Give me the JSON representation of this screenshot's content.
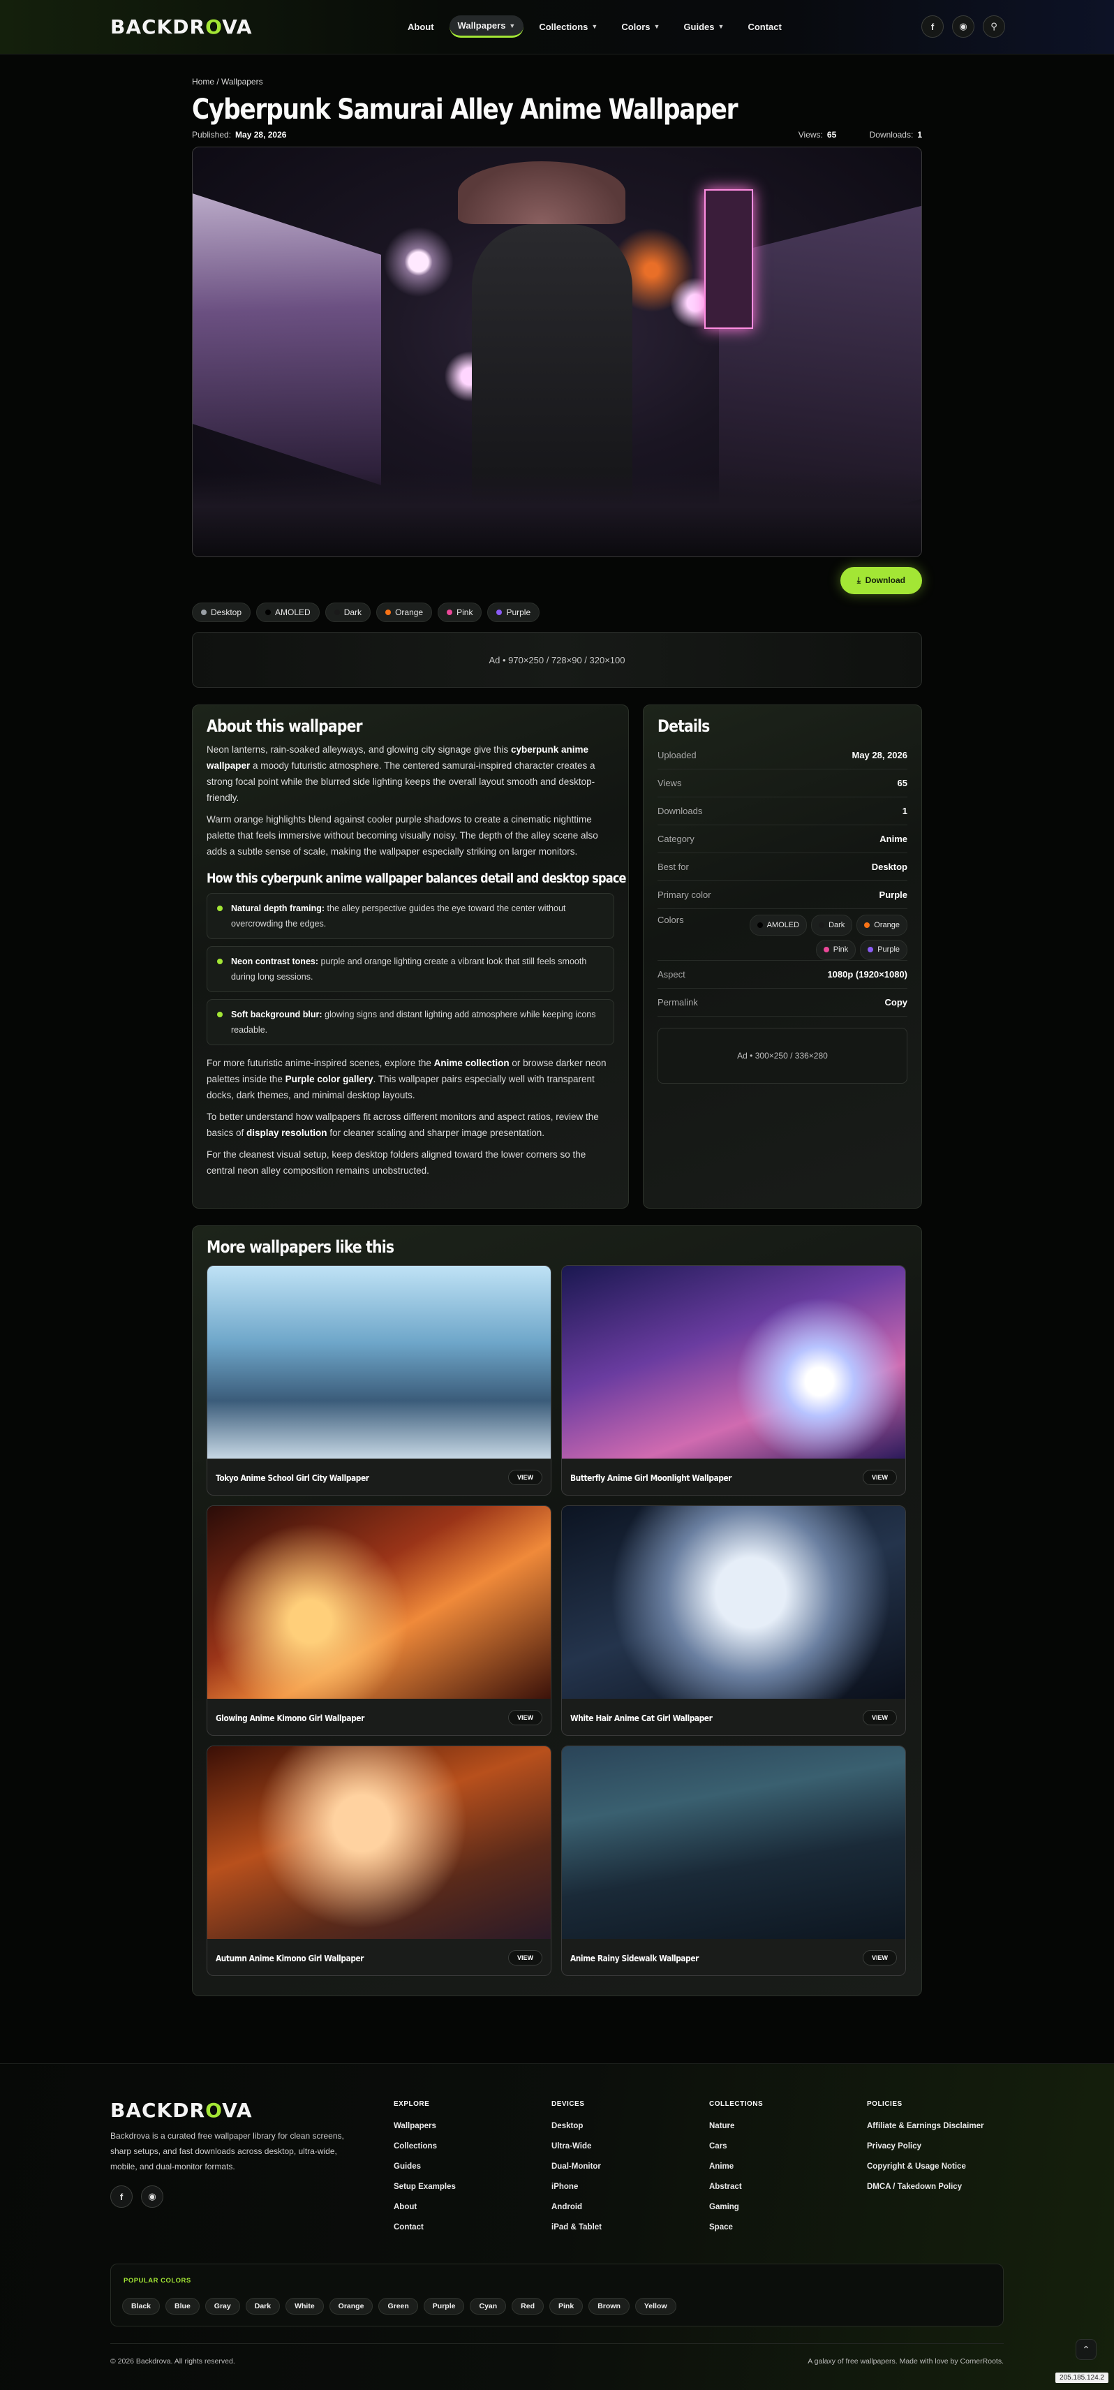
{
  "header": {
    "logo": "BACKDROVA",
    "nav": [
      {
        "label": "About",
        "caret": false,
        "active": false
      },
      {
        "label": "Wallpapers",
        "caret": true,
        "active": true
      },
      {
        "label": "Collections",
        "caret": true,
        "active": false
      },
      {
        "label": "Colors",
        "caret": true,
        "active": false
      },
      {
        "label": "Guides",
        "caret": true,
        "active": false
      },
      {
        "label": "Contact",
        "caret": false,
        "active": false
      }
    ],
    "icons": [
      "facebook-icon",
      "instagram-icon",
      "search-icon"
    ]
  },
  "page": {
    "breadcrumb": "Home / Wallpapers",
    "title": "Cyberpunk Samurai Alley Anime Wallpaper",
    "published_label": "Published:",
    "published": "May 28, 2026",
    "views_label": "Views:",
    "views": "65",
    "downloads_label": "Downloads:",
    "downloads": "1",
    "download_button": "Download",
    "chips": [
      {
        "label": "Desktop",
        "color": "#9aa0a6"
      },
      {
        "label": "AMOLED",
        "color": "#000000"
      },
      {
        "label": "Dark",
        "color": "#1a1a1a"
      },
      {
        "label": "Orange",
        "color": "#f97316"
      },
      {
        "label": "Pink",
        "color": "#ec4899"
      },
      {
        "label": "Purple",
        "color": "#8b5cf6"
      }
    ],
    "ad_banner": "Ad • 970×250 / 728×90 / 320×100"
  },
  "about": {
    "heading": "About this wallpaper",
    "p1_a": "Neon lanterns, rain-soaked alleyways, and glowing city signage give this ",
    "p1_b": "cyberpunk anime wallpaper",
    "p1_c": " a moody futuristic atmosphere. The centered samurai-inspired character creates a strong focal point while the blurred side lighting keeps the overall layout smooth and desktop-friendly.",
    "p2": "Warm orange highlights blend against cooler purple shadows to create a cinematic nighttime palette that feels immersive without becoming visually noisy. The depth of the alley scene also adds a subtle sense of scale, making the wallpaper especially striking on larger monitors.",
    "subheading": "How this cyberpunk anime wallpaper balances detail and desktop space",
    "bullets": [
      {
        "title": "Natural depth framing:",
        "text": " the alley perspective guides the eye toward the center without overcrowding the edges."
      },
      {
        "title": "Neon contrast tones:",
        "text": " purple and orange lighting create a vibrant look that still feels smooth during long sessions."
      },
      {
        "title": "Soft background blur:",
        "text": " glowing signs and distant lighting add atmosphere while keeping icons readable."
      }
    ],
    "p3_a": "For more futuristic anime-inspired scenes, explore the ",
    "p3_b": "Anime collection",
    "p3_c": " or browse darker neon palettes inside the ",
    "p3_d": "Purple color gallery",
    "p3_e": ". This wallpaper pairs especially well with transparent docks, dark themes, and minimal desktop layouts.",
    "p4_a": "To better understand how wallpapers fit across different monitors and aspect ratios, review the basics of ",
    "p4_b": "display resolution",
    "p4_c": " for cleaner scaling and sharper image presentation.",
    "p5": "For the cleanest visual setup, keep desktop folders aligned toward the lower corners so the central neon alley composition remains unobstructed."
  },
  "details": {
    "heading": "Details",
    "rows": [
      {
        "k": "Uploaded",
        "v": "May 28, 2026"
      },
      {
        "k": "Views",
        "v": "65"
      },
      {
        "k": "Downloads",
        "v": "1"
      },
      {
        "k": "Category",
        "v": "Anime"
      },
      {
        "k": "Best for",
        "v": "Desktop"
      },
      {
        "k": "Primary color",
        "v": "Purple"
      }
    ],
    "colors_label": "Colors",
    "colors": [
      {
        "label": "AMOLED",
        "color": "#000000"
      },
      {
        "label": "Dark",
        "color": "#1a1a1a"
      },
      {
        "label": "Orange",
        "color": "#f97316"
      },
      {
        "label": "Pink",
        "color": "#ec4899"
      },
      {
        "label": "Purple",
        "color": "#8b5cf6"
      }
    ],
    "aspect_label": "Aspect",
    "aspect": "1080p (1920×1080)",
    "permalink_label": "Permalink",
    "permalink": "Copy",
    "ad": "Ad • 300×250 / 336×280"
  },
  "more": {
    "heading": "More wallpapers like this",
    "view_label": "VIEW",
    "items": [
      "Tokyo Anime School Girl City Wallpaper",
      "Butterfly Anime Girl Moonlight Wallpaper",
      "Glowing Anime Kimono Girl Wallpaper",
      "White Hair Anime Cat Girl Wallpaper",
      "Autumn Anime Kimono Girl Wallpaper",
      "Anime Rainy Sidewalk Wallpaper"
    ]
  },
  "footer": {
    "logo": "BACKDROVA",
    "desc": "Backdrova is a curated free wallpaper library for clean screens, sharp setups, and fast downloads across desktop, ultra-wide, mobile, and dual-monitor formats.",
    "columns": [
      {
        "title": "EXPLORE",
        "links": [
          "Wallpapers",
          "Collections",
          "Guides",
          "Setup Examples",
          "About",
          "Contact"
        ]
      },
      {
        "title": "DEVICES",
        "links": [
          "Desktop",
          "Ultra-Wide",
          "Dual-Monitor",
          "iPhone",
          "Android",
          "iPad & Tablet"
        ]
      },
      {
        "title": "COLLECTIONS",
        "links": [
          "Nature",
          "Cars",
          "Anime",
          "Abstract",
          "Gaming",
          "Space"
        ]
      },
      {
        "title": "POLICIES",
        "links": [
          "Affiliate & Earnings Disclaimer",
          "Privacy Policy",
          "Copyright & Usage Notice",
          "DMCA / Takedown Policy"
        ]
      }
    ],
    "popular_title": "POPULAR COLORS",
    "popular": [
      "Black",
      "Blue",
      "Gray",
      "Dark",
      "White",
      "Orange",
      "Green",
      "Purple",
      "Cyan",
      "Red",
      "Pink",
      "Brown",
      "Yellow"
    ],
    "copyright": "© 2026 Backdrova. All rights reserved.",
    "tagline": "A galaxy of free wallpapers. Made with love by CornerRoots.",
    "ip": "205.185.124.2"
  }
}
